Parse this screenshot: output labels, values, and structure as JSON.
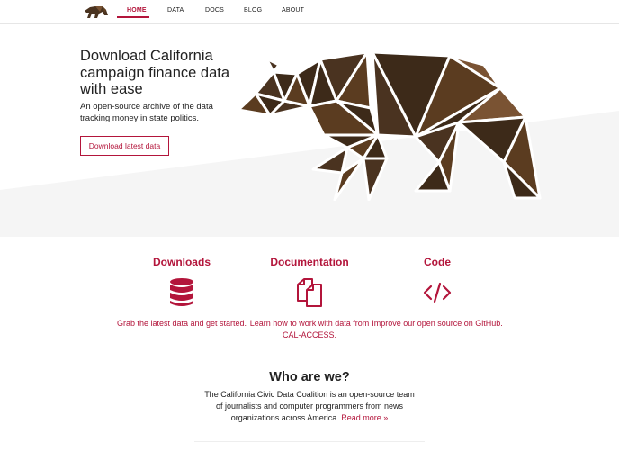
{
  "nav": {
    "items": [
      {
        "label": "HOME",
        "active": true
      },
      {
        "label": "DATA",
        "active": false
      },
      {
        "label": "DOCS",
        "active": false
      },
      {
        "label": "BLOG",
        "active": false
      },
      {
        "label": "ABOUT",
        "active": false
      }
    ]
  },
  "hero": {
    "title": "Download California campaign finance data with ease",
    "subtitle": "An open-source archive of the data tracking money in state politics.",
    "cta_label": "Download latest data"
  },
  "features": [
    {
      "title": "Downloads",
      "icon": "database-icon",
      "text": "Grab the latest data and get started."
    },
    {
      "title": "Documentation",
      "icon": "documents-icon",
      "text": "Learn how to work with data from CAL-ACCESS."
    },
    {
      "title": "Code",
      "icon": "code-icon",
      "text": "Improve our open source on GitHub."
    }
  ],
  "who": {
    "title": "Who are we?",
    "text": "The California Civic Data Coalition is an open-source team of journalists and computer programmers from news organizations across America.",
    "link_label": "Read more »"
  },
  "colors": {
    "accent": "#b3153b",
    "bear_dark": "#3d2a19",
    "bear_mid": "#5b3c20",
    "bear_light": "#7a5333",
    "hero_gray": "#f5f5f5"
  }
}
